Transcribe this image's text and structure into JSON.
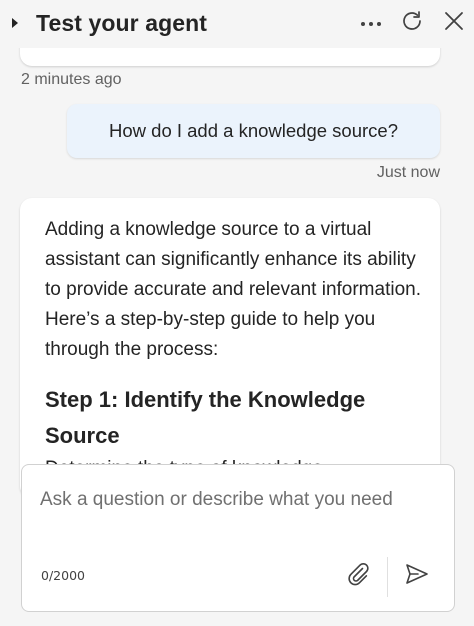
{
  "header": {
    "title": "Test your agent",
    "icons": {
      "collapse": "caret-right-icon",
      "more": "more-horizontal-icon",
      "refresh": "refresh-icon",
      "close": "close-icon"
    }
  },
  "conversation": {
    "previous_timestamp": "2 minutes ago",
    "user_message": "How do I add a knowledge source?",
    "user_timestamp": "Just now",
    "bot_reply": {
      "intro": "Adding a knowledge source to a virtual assistant can significantly enhance its ability to provide accurate and relevant information. Here’s a step-by-step guide to help you through the process:",
      "step_heading": "Step 1: Identify the Knowledge Source",
      "step_text_partial": "Determine the type of knowledge"
    }
  },
  "composer": {
    "placeholder": "Ask a question or describe what you need",
    "counter": "0/2000",
    "icons": {
      "attach": "paperclip-icon",
      "send": "send-icon"
    }
  },
  "colors": {
    "background": "#f5f5f5",
    "user_bubble": "#ebf3fc",
    "card": "#ffffff",
    "muted_text": "#616161"
  }
}
